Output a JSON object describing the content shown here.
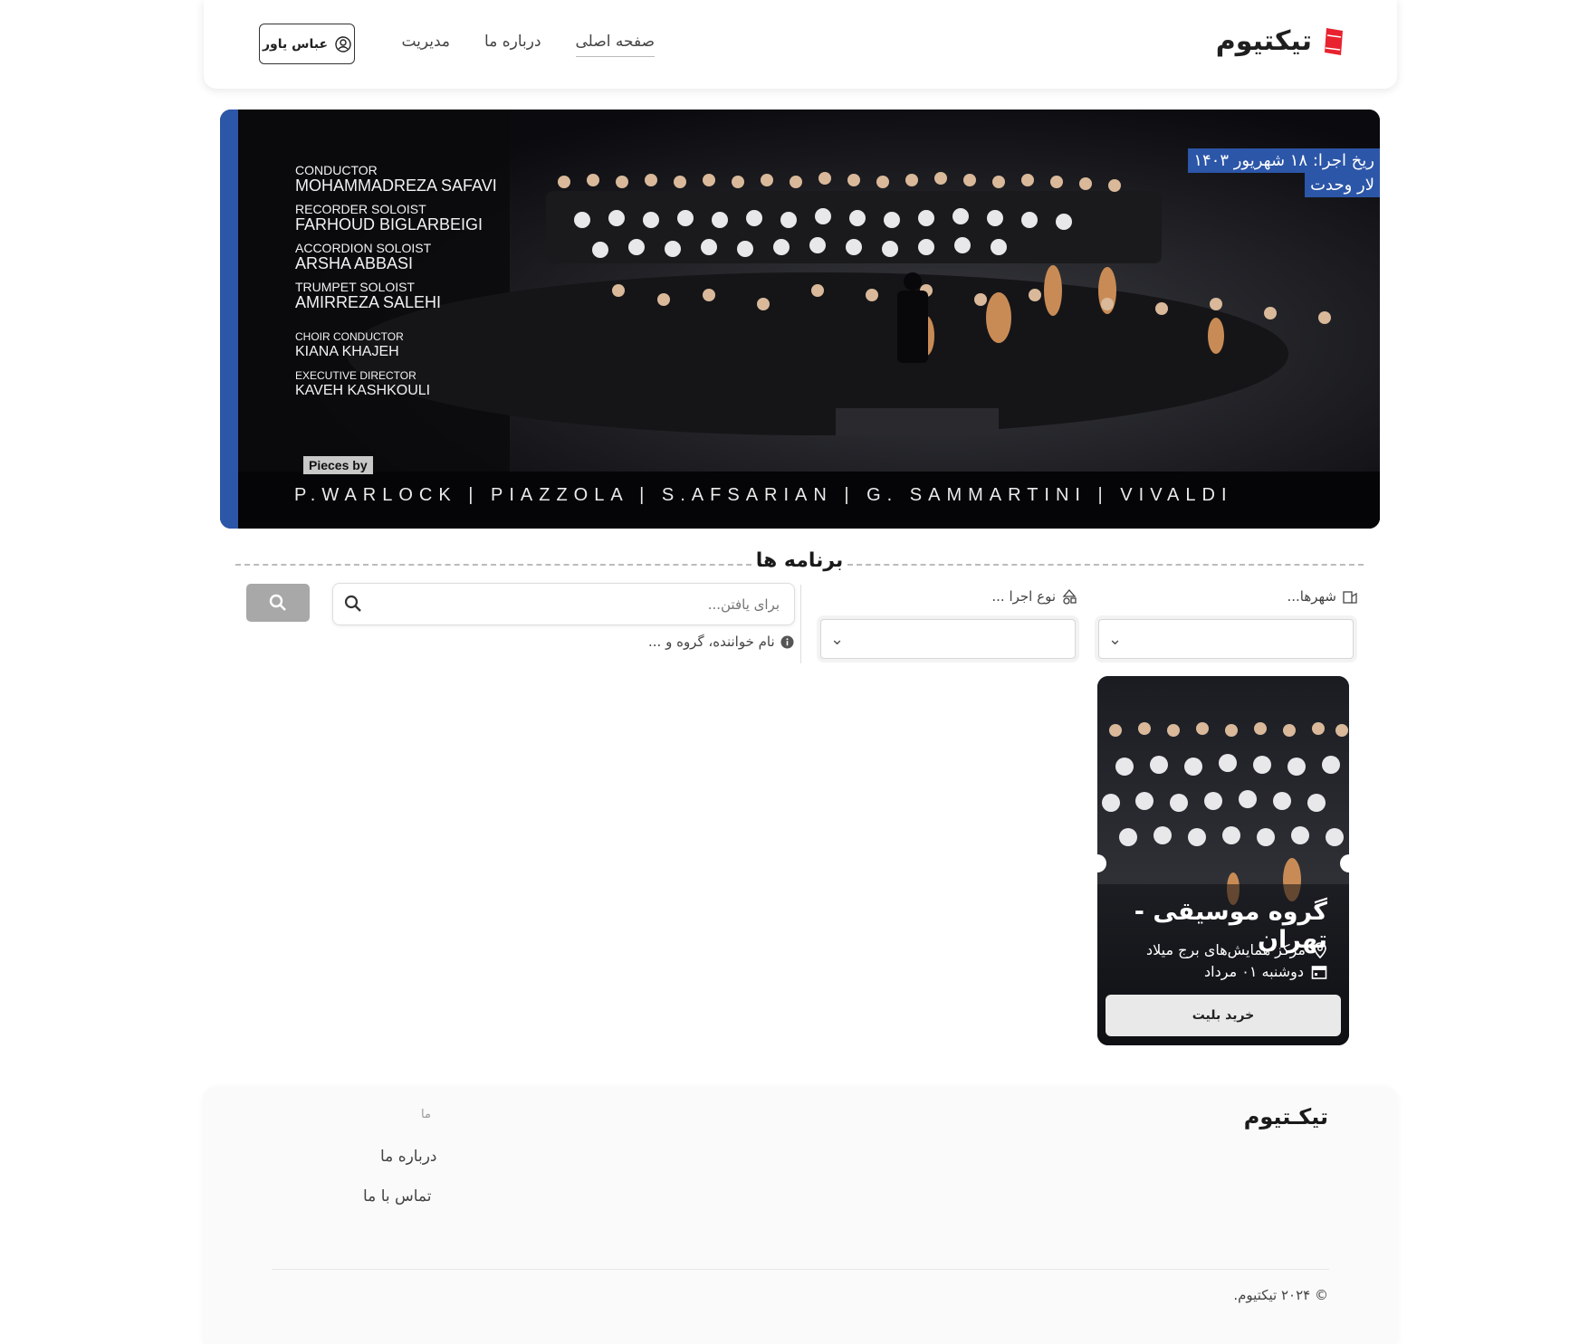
{
  "header": {
    "logo_text": "تیکتیوم",
    "nav": [
      {
        "label": "صفحه اصلی",
        "active": true
      },
      {
        "label": "درباره ما",
        "active": false
      },
      {
        "label": "مدیریت",
        "active": false
      }
    ],
    "user_name": "عباس یاور",
    "accent_color": "#e8222e"
  },
  "banner": {
    "credits": [
      {
        "role": "CONDUCTOR",
        "name": "MOHAMMADREZA SAFAVI"
      },
      {
        "role": "RECORDER SOLOIST",
        "name": "FARHOUD BIGLARBEIGI"
      },
      {
        "role": "ACCORDION SOLOIST",
        "name": "ARSHA ABBASI"
      },
      {
        "role": "TRUMPET SOLOIST",
        "name": "AMIRREZA SALEHI"
      },
      {
        "role": "CHOIR CONDUCTOR",
        "name": "KIANA KHAJEH"
      },
      {
        "role": "EXECUTIVE DIRECTOR",
        "name": "KAVEH KASHKOULI"
      }
    ],
    "pieces_label": "Pieces by",
    "composers": "P.WARLOCK | PIAZZOLA | S.AFSARIAN | G. SAMMARTINI | VIVALDI",
    "date_line": "ریخ اجرا: ۱۸ شهریور ۱۴۰۳",
    "venue_line": "لار وحدت",
    "stripe_color": "#2c56a8"
  },
  "section": {
    "title": "برنامه ها"
  },
  "filters": {
    "cities_label": "شهرها...",
    "type_label": "نوع اجرا ...",
    "cities_value": "",
    "type_value": "",
    "search_placeholder": "برای یافتن...",
    "search_value": "",
    "search_hint": "نام خواننده، گروه و ..."
  },
  "events": [
    {
      "title": "گروه موسیقی - تهران",
      "venue": "مرکز همایش‌های برج میلاد",
      "date": "دوشنبه ۰۱ مرداد",
      "buy_label": "خرید بلیت"
    }
  ],
  "footer": {
    "brand": "تیکـتیوم",
    "links_heading": "ما",
    "links": [
      "درباره ما",
      "تماس با ما"
    ],
    "copyright": "© ۲۰۲۴ تیکتیوم."
  }
}
